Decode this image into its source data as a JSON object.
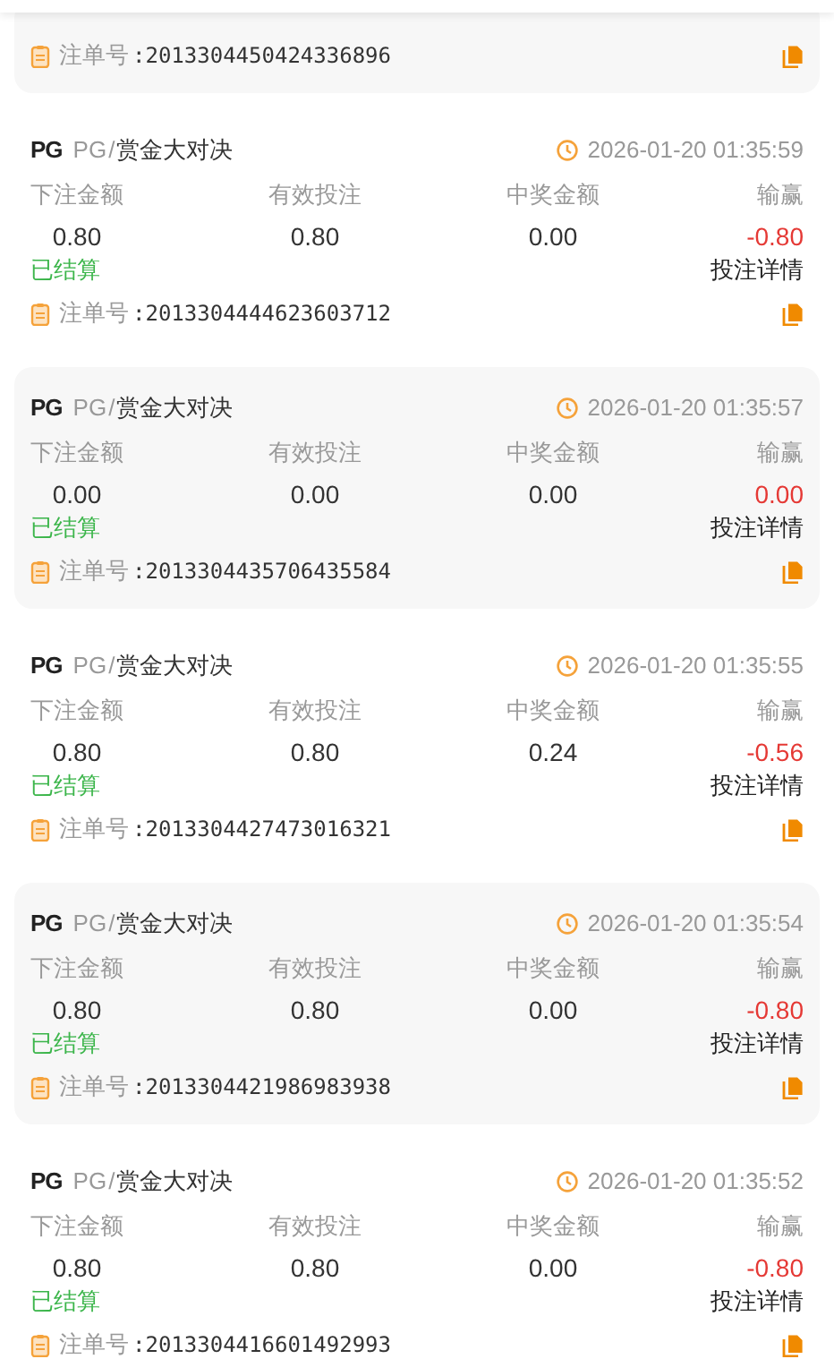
{
  "records": [
    {
      "order_label": "注单号",
      "order_no": ":2013304450424336896"
    },
    {
      "logo": "PG",
      "provider": "PG",
      "separator": "/",
      "game": "赏金大对决",
      "time": "2026-01-20 01:35:59",
      "columns": [
        {
          "label": "下注金额",
          "value": "0.80"
        },
        {
          "label": "有效投注",
          "value": "0.80"
        },
        {
          "label": "中奖金额",
          "value": "0.00"
        },
        {
          "label": "输赢",
          "value": "-0.80"
        }
      ],
      "status": "已结算",
      "detail_link": "投注详情",
      "order_label": "注单号",
      "order_no": ":2013304444623603712"
    },
    {
      "logo": "PG",
      "provider": "PG",
      "separator": "/",
      "game": "赏金大对决",
      "time": "2026-01-20 01:35:57",
      "columns": [
        {
          "label": "下注金额",
          "value": "0.00"
        },
        {
          "label": "有效投注",
          "value": "0.00"
        },
        {
          "label": "中奖金额",
          "value": "0.00"
        },
        {
          "label": "输赢",
          "value": "0.00"
        }
      ],
      "status": "已结算",
      "detail_link": "投注详情",
      "order_label": "注单号",
      "order_no": ":2013304435706435584"
    },
    {
      "logo": "PG",
      "provider": "PG",
      "separator": "/",
      "game": "赏金大对决",
      "time": "2026-01-20 01:35:55",
      "columns": [
        {
          "label": "下注金额",
          "value": "0.80"
        },
        {
          "label": "有效投注",
          "value": "0.80"
        },
        {
          "label": "中奖金额",
          "value": "0.24"
        },
        {
          "label": "输赢",
          "value": "-0.56"
        }
      ],
      "status": "已结算",
      "detail_link": "投注详情",
      "order_label": "注单号",
      "order_no": ":2013304427473016321"
    },
    {
      "logo": "PG",
      "provider": "PG",
      "separator": "/",
      "game": "赏金大对决",
      "time": "2026-01-20 01:35:54",
      "columns": [
        {
          "label": "下注金额",
          "value": "0.80"
        },
        {
          "label": "有效投注",
          "value": "0.80"
        },
        {
          "label": "中奖金额",
          "value": "0.00"
        },
        {
          "label": "输赢",
          "value": "-0.80"
        }
      ],
      "status": "已结算",
      "detail_link": "投注详情",
      "order_label": "注单号",
      "order_no": ":2013304421986983938"
    },
    {
      "logo": "PG",
      "provider": "PG",
      "separator": "/",
      "game": "赏金大对决",
      "time": "2026-01-20 01:35:52",
      "columns": [
        {
          "label": "下注金额",
          "value": "0.80"
        },
        {
          "label": "有效投注",
          "value": "0.80"
        },
        {
          "label": "中奖金额",
          "value": "0.00"
        },
        {
          "label": "输赢",
          "value": "-0.80"
        }
      ],
      "status": "已结算",
      "detail_link": "投注详情",
      "order_label": "注单号",
      "order_no": ":2013304416601492993"
    }
  ]
}
